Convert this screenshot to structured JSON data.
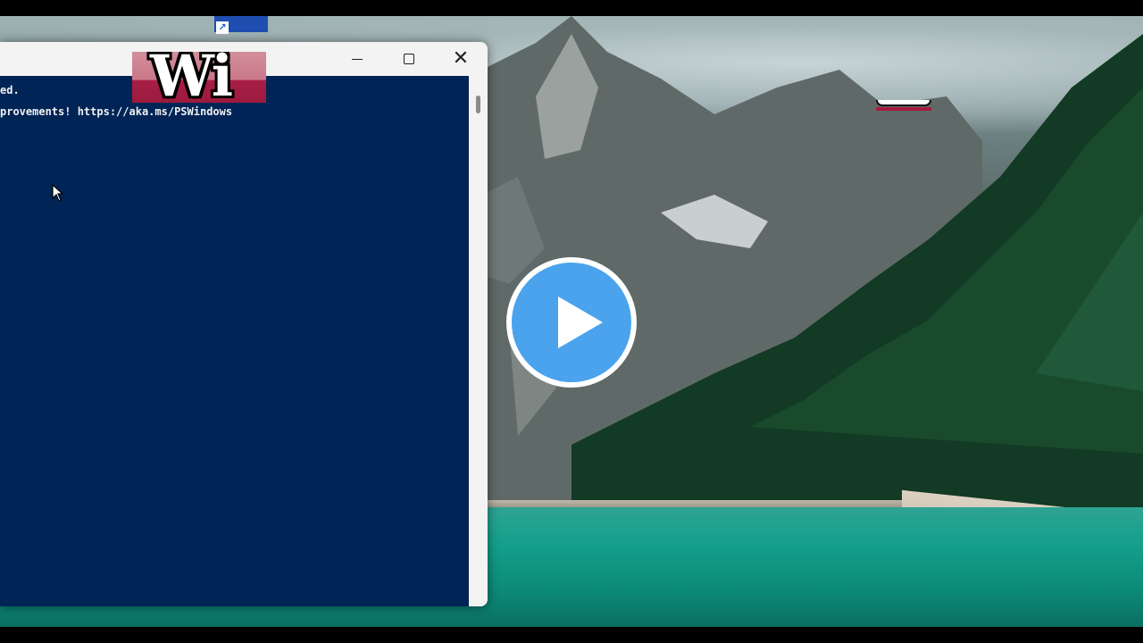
{
  "desktop": {
    "wallpaper": "mountain-lake-forest",
    "shortcut_icon": "shortcut-arrow-icon"
  },
  "terminal": {
    "title_logo_text": "Wi",
    "lines": [
      "ed.",
      "provements! https://aka.ms/PSWindows"
    ],
    "background_color": "#012456",
    "controls": {
      "minimize": "minimize-icon",
      "maximize": "maximize-icon",
      "close": "✕"
    }
  },
  "overlay": {
    "play_button_color": "#4aa3ec",
    "icon": "play-icon"
  }
}
